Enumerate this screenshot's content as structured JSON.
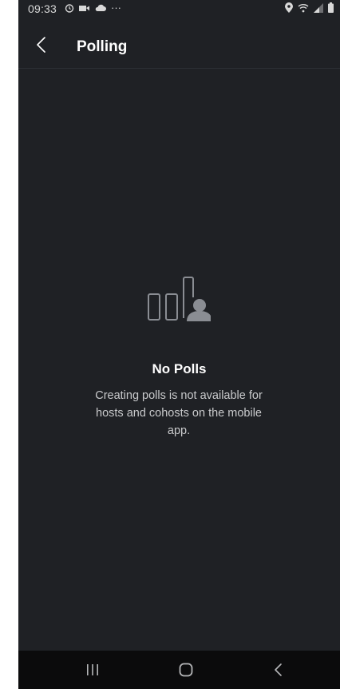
{
  "status_bar": {
    "time": "09:33",
    "left_icons": [
      "alarm-icon",
      "video-icon",
      "cloud-icon",
      "more-dots-icon"
    ],
    "right_icons": [
      "location-icon",
      "wifi-icon",
      "signal-icon",
      "battery-icon"
    ],
    "more_glyph": "···"
  },
  "header": {
    "title": "Polling"
  },
  "empty_state": {
    "title": "No Polls",
    "message": "Creating polls is not available for hosts and cohosts on the mobile app.",
    "icon": "poll-chart-person-icon"
  },
  "nav_bar": {
    "buttons": [
      "recents-button",
      "home-button",
      "back-button"
    ]
  },
  "colors": {
    "background": "#1f2125",
    "text_primary": "#ffffff",
    "text_secondary": "#c9cacc",
    "illustration": "#8a8d93",
    "nav_bar": "#0b0b0c"
  }
}
